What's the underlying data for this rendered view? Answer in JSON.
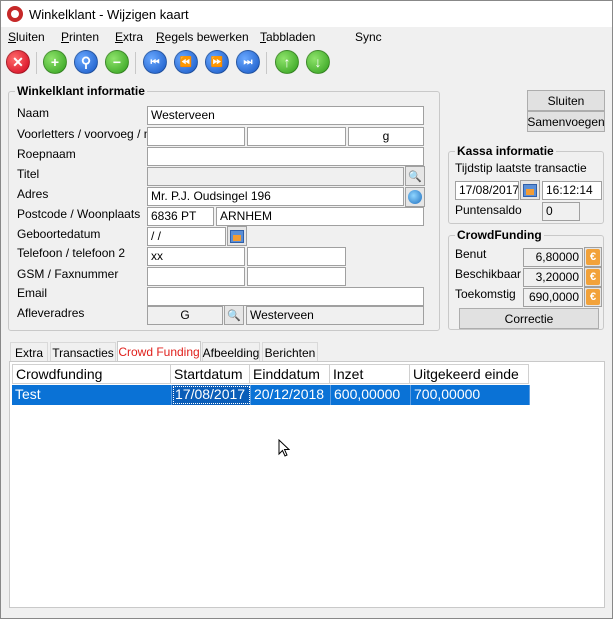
{
  "window": {
    "title": "Winkelklant - Wijzigen kaart",
    "app_icon": "app-logo-icon"
  },
  "menu": [
    {
      "label": "Sluiten",
      "mnemonic": "S"
    },
    {
      "label": "Printen",
      "mnemonic": "P"
    },
    {
      "label": "Extra",
      "mnemonic": "E"
    },
    {
      "label": "Regels bewerken",
      "mnemonic": "R"
    },
    {
      "label": "Tabbladen",
      "mnemonic": "T"
    },
    {
      "label": "Sync",
      "mnemonic": ""
    }
  ],
  "toolbar": {
    "buttons": [
      {
        "name": "close-red-button",
        "icon": "close-icon",
        "glyph": "✕",
        "color": "#d0021b"
      },
      {
        "name": "add-button",
        "icon": "plus-icon",
        "glyph": "+",
        "color": "#2f9e1b"
      },
      {
        "name": "search-button",
        "icon": "search-icon",
        "glyph": "⚲",
        "color": "#2f9e1b"
      },
      {
        "name": "remove-button",
        "icon": "minus-icon",
        "glyph": "−",
        "color": "#2f9e1b"
      },
      {
        "name": "first-record-button",
        "icon": "skip-first-icon",
        "glyph": "⏮",
        "color": "#1556c4"
      },
      {
        "name": "previous-record-button",
        "icon": "rewind-icon",
        "glyph": "⏪",
        "color": "#1556c4"
      },
      {
        "name": "next-record-button",
        "icon": "fast-forward-icon",
        "glyph": "⏩",
        "color": "#1556c4"
      },
      {
        "name": "last-record-button",
        "icon": "skip-last-icon",
        "glyph": "⏭",
        "color": "#1556c4"
      },
      {
        "name": "move-up-button",
        "icon": "arrow-up-icon",
        "glyph": "↑",
        "color": "#2f9e1b"
      },
      {
        "name": "move-down-button",
        "icon": "arrow-down-icon",
        "glyph": "↓",
        "color": "#2f9e1b"
      }
    ]
  },
  "klant": {
    "group_title": "Winkelklant informatie",
    "labels": {
      "naam": "Naam",
      "voorletters": "Voorletters / voorvoeg / nr",
      "roepnaam": "Roepnaam",
      "titel": "Titel",
      "adres": "Adres",
      "postcode": "Postcode / Woonplaats",
      "geboortedatum": "Geboortedatum",
      "telefoon": "Telefoon / telefoon 2",
      "gsm": "GSM / Faxnummer",
      "email": "Email",
      "afleveradres": "Afleveradres"
    },
    "values": {
      "naam": "Westerveen",
      "voorletters": "",
      "voorvoeg": "",
      "nr": "g",
      "roepnaam": "",
      "titel": "",
      "adres": "Mr. P.J. Oudsingel 196",
      "postcode": "6836 PT",
      "woonplaats": "ARNHEM",
      "geboortedatum": " / /",
      "telefoon": "xx",
      "telefoon2": "",
      "gsm": "",
      "fax": "",
      "email": "",
      "afleveradres_code": "G",
      "afleveradres_naam": "Westerveen"
    }
  },
  "buttons": {
    "sluiten": "Sluiten",
    "samenvoegen": "Samenvoegen",
    "correctie": "Correctie"
  },
  "kassa": {
    "group_title": "Kassa informatie",
    "tijdstip_label": "Tijdstip laatste transactie",
    "datum": "17/08/2017",
    "tijd": "16:12:14",
    "puntensaldo_label": "Puntensaldo",
    "puntensaldo": "0"
  },
  "crowdfunding": {
    "group_title": "CrowdFunding",
    "benut_label": "Benut",
    "benut": "6,80000",
    "beschikbaar_label": "Beschikbaar",
    "beschikbaar": "3,20000",
    "toekomstig_label": "Toekomstig",
    "toekomstig": "690,0000"
  },
  "tabs": [
    {
      "label": "Extra",
      "active": false
    },
    {
      "label": "Transacties",
      "active": false
    },
    {
      "label": "Crowd Funding",
      "active": true
    },
    {
      "label": "Afbeelding",
      "active": false
    },
    {
      "label": "Berichten",
      "active": false
    }
  ],
  "grid": {
    "columns": [
      "Crowdfunding",
      "Startdatum",
      "Einddatum",
      "Inzet",
      "Uitgekeerd einde"
    ],
    "rows": [
      [
        "Test",
        "17/08/2017",
        "20/12/2018",
        "600,00000",
        "700,00000"
      ]
    ]
  },
  "colors": {
    "selection": "#0a72d6",
    "active_tab_text": "#e0201c"
  }
}
